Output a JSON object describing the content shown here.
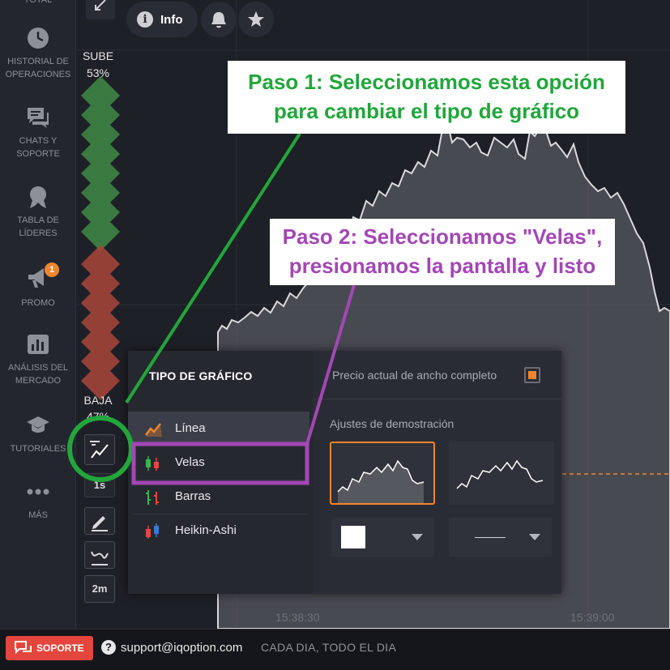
{
  "sidebar": {
    "total": "TOTAL",
    "items": [
      {
        "icon": "clock-icon",
        "label": "HISTORIAL DE OPERACIONES"
      },
      {
        "icon": "chat-icon",
        "label": "CHATS Y SOPORTE"
      },
      {
        "icon": "award-icon",
        "label": "TABLA DE LÍDERES"
      },
      {
        "icon": "megaphone-icon",
        "label": "PROMO",
        "badge": "1"
      },
      {
        "icon": "bar-chart-icon",
        "label": "ANÁLISIS DEL MERCADO"
      },
      {
        "icon": "graduation-cap-icon",
        "label": "TUTORIALES"
      },
      {
        "icon": "more-dots-icon",
        "label": "MÁS"
      }
    ]
  },
  "topbar": {
    "info_label": "Info"
  },
  "sentiment": {
    "up_label": "SUBE",
    "up_pct": "53%",
    "down_label": "BAJA",
    "down_pct": "47%"
  },
  "tools": {
    "tf1": "1s",
    "tf2": "2m"
  },
  "time_axis": {
    "t1": "15:38:30",
    "t2": "15:39:00"
  },
  "panel": {
    "title": "TIPO DE GRÁFICO",
    "chart_types": [
      "Línea",
      "Velas",
      "Barras",
      "Heikin-Ashi"
    ],
    "full_width_label": "Precio actual de ancho completo",
    "demo_label": "Ajustes de demostración"
  },
  "annotations": {
    "step1_line1": "Paso 1: Seleccionamos esta opción",
    "step1_line2": "para cambiar el tipo de gráfico",
    "step2_line1": "Paso 2: Seleccionamos \"Velas\",",
    "step2_line2": "presionamos la pantalla y listo"
  },
  "footer": {
    "support_label": "SOPORTE",
    "email": "support@iqoption.com",
    "hours": "CADA DIA, TODO EL DIA"
  },
  "colors": {
    "accent": "#f0852d",
    "green": "#22a63b",
    "purple": "#a347b5",
    "support_red": "#e4463d"
  }
}
